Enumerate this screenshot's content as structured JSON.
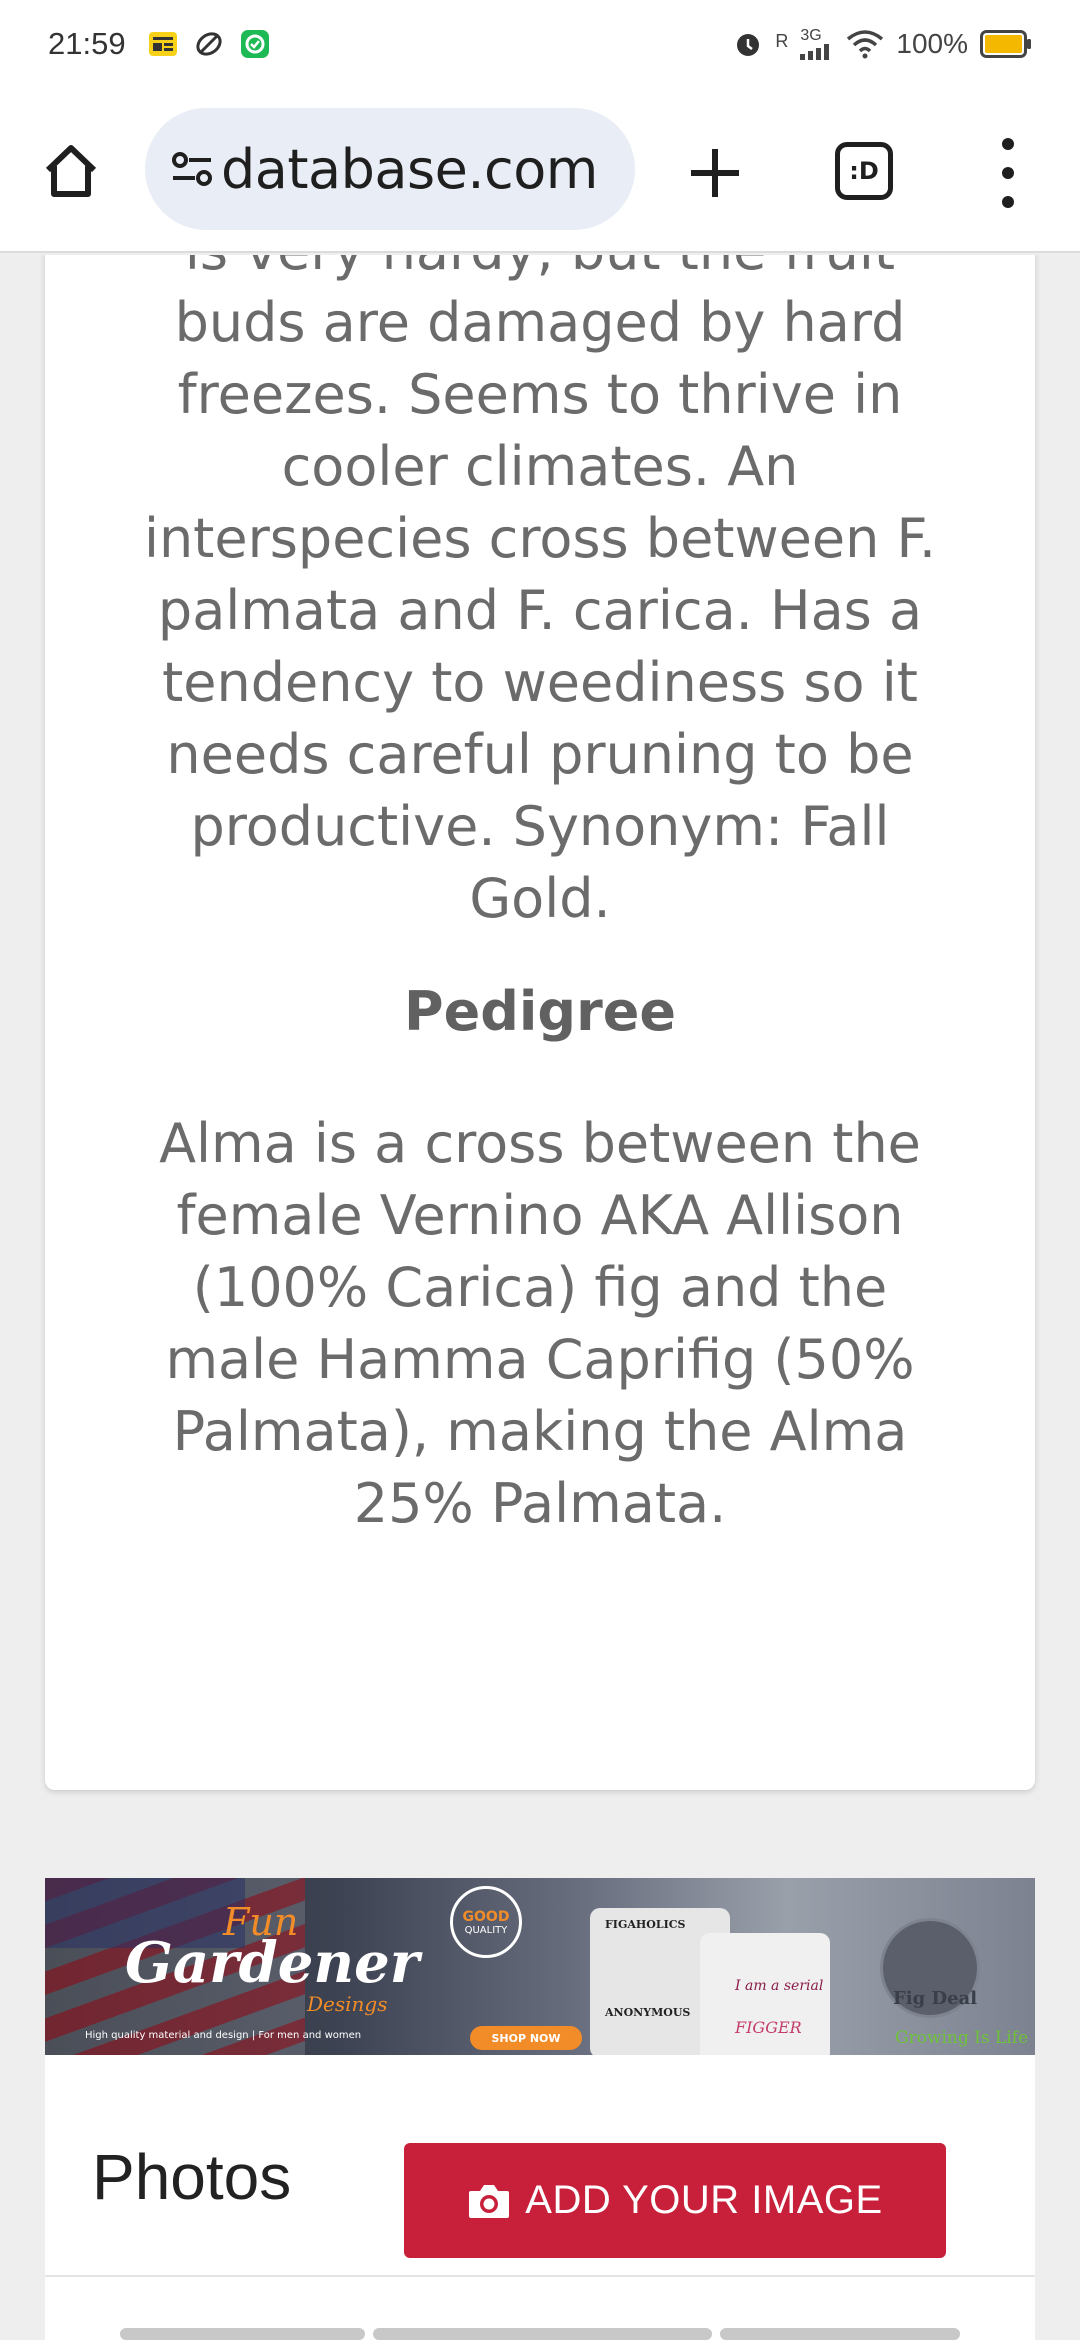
{
  "status_bar": {
    "time": "21:59",
    "network": "3G",
    "roaming": "R",
    "battery": "100%",
    "battery_color": "#f5b800"
  },
  "browser": {
    "url": "database.com",
    "tabs_glyph": ":D"
  },
  "article": {
    "description": "is very hardy, but the fruit buds are damaged by hard freezes. Seems to thrive in cooler climates. An interspecies cross between F. palmata and F. carica. Has a tendency to weediness so it needs careful pruning to be productive. Synonym: Fall Gold.",
    "pedigree_title": "Pedigree",
    "pedigree_text": "Alma is a cross between the female Vernino AKA Allison (100% Carica) fig and the male Hamma Caprifig (50% Palmata), making the Alma 25% Palmata."
  },
  "banner": {
    "fun": "Fun",
    "gardener": "Gardener",
    "designs": "Desings",
    "tagline": "High quality material and design | For men and women",
    "good": "GOOD",
    "quality": "QUALITY",
    "shop_now": "SHOP NOW",
    "shirt_a": "FIGAHOLICS",
    "shirt_b": "ANONYMOUS",
    "shirt_c": "I am a serial",
    "shirt_d": "FIGGER",
    "fig_deal": "Fig Deal",
    "growing": "Growing Is Life"
  },
  "photos": {
    "title": "Photos",
    "add_button": "ADD YOUR IMAGE",
    "accent": "#c8203a"
  }
}
